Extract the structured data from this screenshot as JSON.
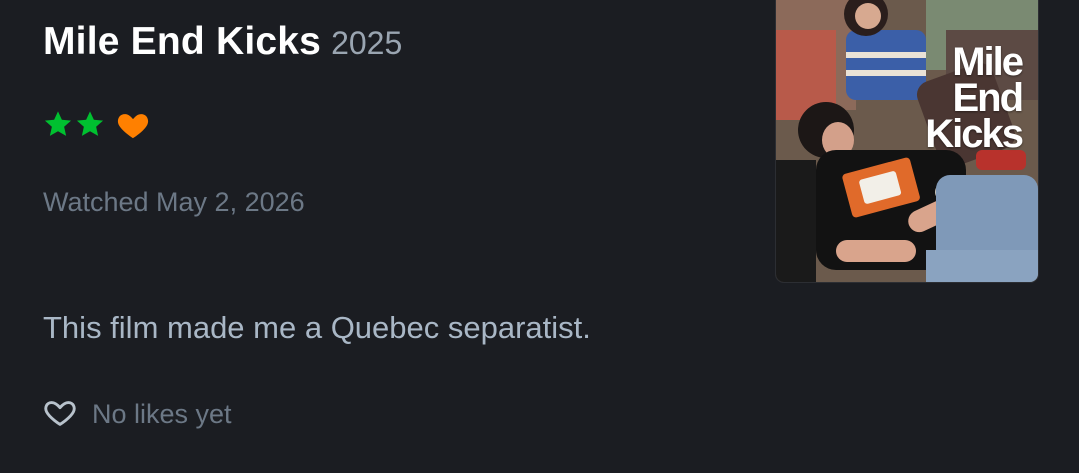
{
  "review": {
    "film_title": "Mile End Kicks",
    "year": "2025",
    "rating": {
      "stars": 2,
      "liked": true,
      "star_color": "#00c030",
      "heart_color": "#ff8000"
    },
    "watched_label": "Watched May 2, 2026",
    "body": "This film made me a Quebec separatist.",
    "likes_label": "No likes yet"
  },
  "poster": {
    "title_lines": [
      "Mile",
      "End",
      "Kicks"
    ]
  },
  "icons": {
    "rating_star": "star-icon",
    "liked": "heart-filled-icon",
    "like_action": "heart-outline-icon"
  }
}
